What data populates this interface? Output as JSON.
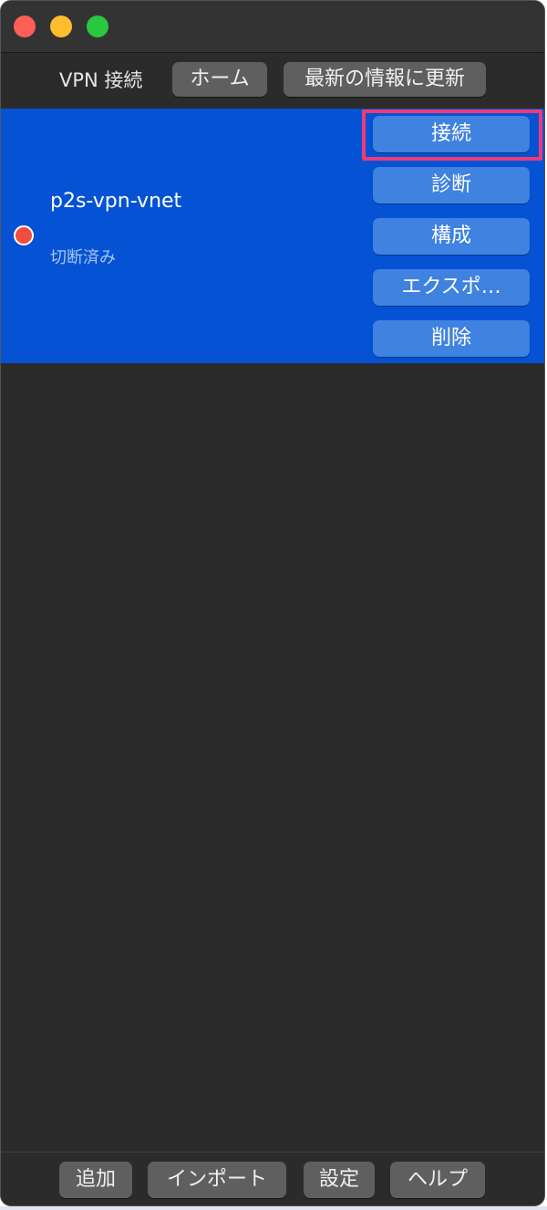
{
  "window": {
    "controls": [
      "close",
      "minimize",
      "zoom"
    ],
    "colors": {
      "close": "#fe5f57",
      "minimize": "#febc2e",
      "zoom": "#28c840"
    }
  },
  "toolbar": {
    "title": "VPN 接続",
    "home_label": "ホーム",
    "refresh_label": "最新の情報に更新"
  },
  "connections": [
    {
      "name": "p2s-vpn-vnet",
      "status": "切断済み",
      "status_color": "#f24b3f",
      "selected": true,
      "actions": {
        "connect": "接続",
        "diagnose": "診断",
        "configure": "構成",
        "export": "エクスポ…",
        "delete": "削除"
      }
    }
  ],
  "footer": {
    "add_label": "追加",
    "import_label": "インポート",
    "settings_label": "設定",
    "help_label": "ヘルプ"
  },
  "colors": {
    "selection": "#0553d4",
    "action_button": "#3f82e0",
    "highlight_box": "#f03a76",
    "window_bg": "#2b2b2b"
  }
}
